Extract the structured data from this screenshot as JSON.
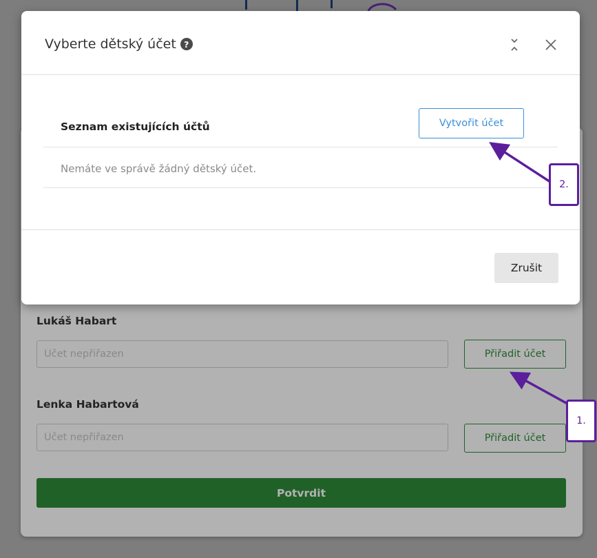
{
  "background": {
    "people": [
      {
        "name": "Lukáš Habart",
        "placeholder": "Účet nepřiřazen",
        "button": "Přiřadit účet"
      },
      {
        "name": "Lenka Habartová",
        "placeholder": "Účet nepřiřazen",
        "button": "Přiřadit účet"
      }
    ],
    "confirm_label": "Potvrdit"
  },
  "modal": {
    "title": "Vyberte dětský účet",
    "help_icon": "?",
    "list_title": "Seznam existujících účtů",
    "create_label": "Vytvořit účet",
    "empty_text": "Nemáte ve správě žádný dětský účet.",
    "cancel_label": "Zrušit"
  },
  "annotations": [
    {
      "label": "1."
    },
    {
      "label": "2."
    }
  ],
  "colors": {
    "green": "#2e8b3a",
    "blue": "#3a8fd9",
    "annotation": "#5b1f9c"
  },
  "icons": [
    "help-icon",
    "collapse-icon",
    "close-icon"
  ]
}
